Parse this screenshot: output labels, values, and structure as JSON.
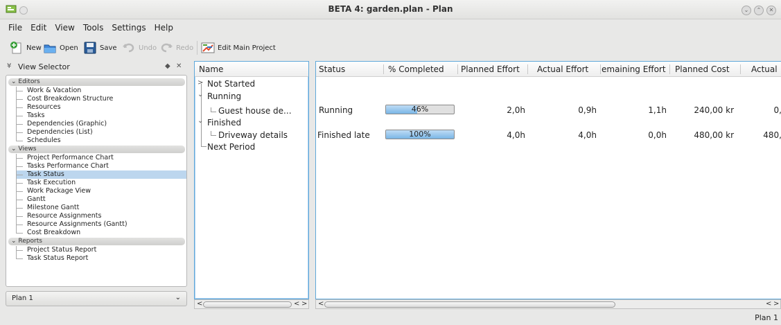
{
  "window": {
    "title": "BETA 4: garden.plan - Plan"
  },
  "menu": [
    "File",
    "Edit",
    "View",
    "Tools",
    "Settings",
    "Help"
  ],
  "toolbar": {
    "new": "New",
    "open": "Open",
    "save": "Save",
    "undo": "Undo",
    "redo": "Redo",
    "edit_main_project": "Edit Main Project"
  },
  "view_selector": {
    "title": "View Selector",
    "sections": [
      {
        "title": "Editors",
        "items": [
          "Work & Vacation",
          "Cost Breakdown Structure",
          "Resources",
          "Tasks",
          "Dependencies (Graphic)",
          "Dependencies (List)",
          "Schedules"
        ]
      },
      {
        "title": "Views",
        "items": [
          "Project Performance Chart",
          "Tasks Performance Chart",
          "Task Status",
          "Task Execution",
          "Work Package View",
          "Gantt",
          "Milestone Gantt",
          "Resource Assignments",
          "Resource Assignments (Gantt)",
          "Cost Breakdown"
        ]
      },
      {
        "title": "Reports",
        "items": [
          "Project Status Report",
          "Task Status Report"
        ]
      }
    ],
    "selected": "Task Status"
  },
  "plan_combo": {
    "value": "Plan 1"
  },
  "name_tree": {
    "header": "Name",
    "rows": [
      "Not Started",
      "Running",
      "Guest house de...",
      "Finished",
      "Driveway details",
      "Next Period"
    ]
  },
  "table": {
    "headers": [
      "Status",
      "% Completed",
      "Planned Effort",
      "Actual Effort",
      "emaining Effort",
      "Planned Cost",
      "Actual"
    ],
    "rows": [
      {
        "status": "Running",
        "completed": 46,
        "completed_label": "46%",
        "planned_effort": "2,0h",
        "actual_effort": "0,9h",
        "remaining_effort": "1,1h",
        "planned_cost": "240,00 kr",
        "actual": "0,"
      },
      {
        "status": "Finished late",
        "completed": 100,
        "completed_label": "100%",
        "planned_effort": "4,0h",
        "actual_effort": "4,0h",
        "remaining_effort": "0,0h",
        "planned_cost": "480,00 kr",
        "actual": "480,"
      }
    ]
  },
  "status_bar": {
    "text": "Plan 1"
  },
  "colors": {
    "selection": "#bcd6ee",
    "focus_border": "#5fa8da",
    "progress_fill": "#7ab6e6"
  }
}
